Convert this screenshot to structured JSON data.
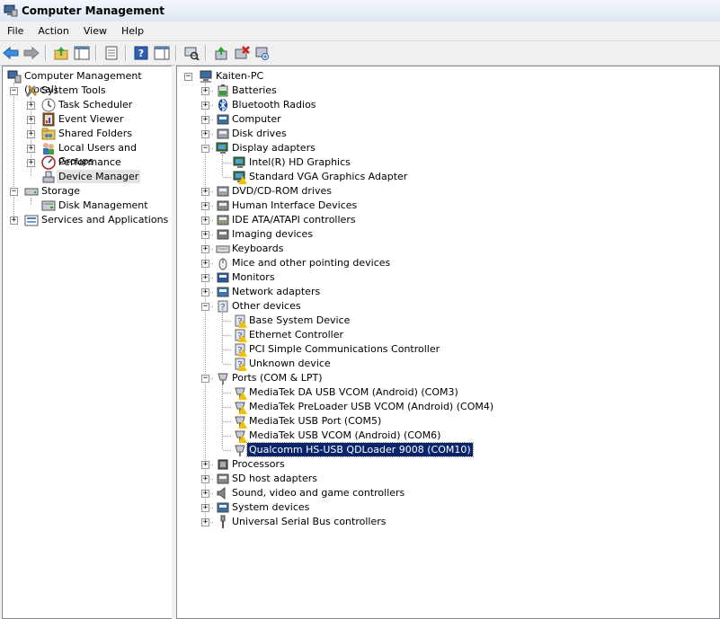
{
  "window": {
    "title": "Computer Management"
  },
  "menu": [
    "File",
    "Action",
    "View",
    "Help"
  ],
  "toolbar": {
    "buttons": [
      "back-arrow-icon",
      "forward-arrow-icon",
      "up-folder-icon",
      "show-hide-tree-icon",
      "properties-icon",
      "help-icon",
      "action-pane-icon",
      "scan-hardware-icon",
      "update-driver-icon",
      "uninstall-icon",
      "disable-icon"
    ]
  },
  "left_tree": {
    "root": "Computer Management (Local)",
    "system_tools": "System Tools",
    "task_scheduler": "Task Scheduler",
    "event_viewer": "Event Viewer",
    "shared_folders": "Shared Folders",
    "local_users": "Local Users and Groups",
    "performance": "Performance",
    "device_manager": "Device Manager",
    "storage": "Storage",
    "disk_management": "Disk Management",
    "services_apps": "Services and Applications"
  },
  "device_tree": {
    "root": "Kaiten-PC",
    "batteries": "Batteries",
    "bluetooth": "Bluetooth Radios",
    "computer": "Computer",
    "disk_drives": "Disk drives",
    "display_adapters": "Display adapters",
    "intel_hd": "Intel(R) HD Graphics",
    "std_vga": "Standard VGA Graphics Adapter",
    "dvd": "DVD/CD-ROM drives",
    "hid": "Human Interface Devices",
    "ide": "IDE ATA/ATAPI controllers",
    "imaging": "Imaging devices",
    "keyboards": "Keyboards",
    "mice": "Mice and other pointing devices",
    "monitors": "Monitors",
    "network": "Network adapters",
    "other_devices": "Other devices",
    "base_system": "Base System Device",
    "ethernet": "Ethernet Controller",
    "pci_comm": "PCI Simple Communications Controller",
    "unknown": "Unknown device",
    "ports": "Ports (COM & LPT)",
    "mtk_da": "MediaTek DA USB VCOM (Android) (COM3)",
    "mtk_preloader": "MediaTek PreLoader USB VCOM (Android) (COM4)",
    "mtk_port": "MediaTek USB Port (COM5)",
    "mtk_vcom": "MediaTek USB VCOM (Android) (COM6)",
    "qualcomm": "Qualcomm HS-USB QDLoader 9008 (COM10)",
    "processors": "Processors",
    "sd_host": "SD host adapters",
    "sound": "Sound, video and game controllers",
    "system_devices": "System devices",
    "usb": "Universal Serial Bus controllers"
  },
  "colors": {
    "selection_active": "#0a246a",
    "selection_inactive": "#e3e3e3",
    "warning": "#f2c200"
  }
}
